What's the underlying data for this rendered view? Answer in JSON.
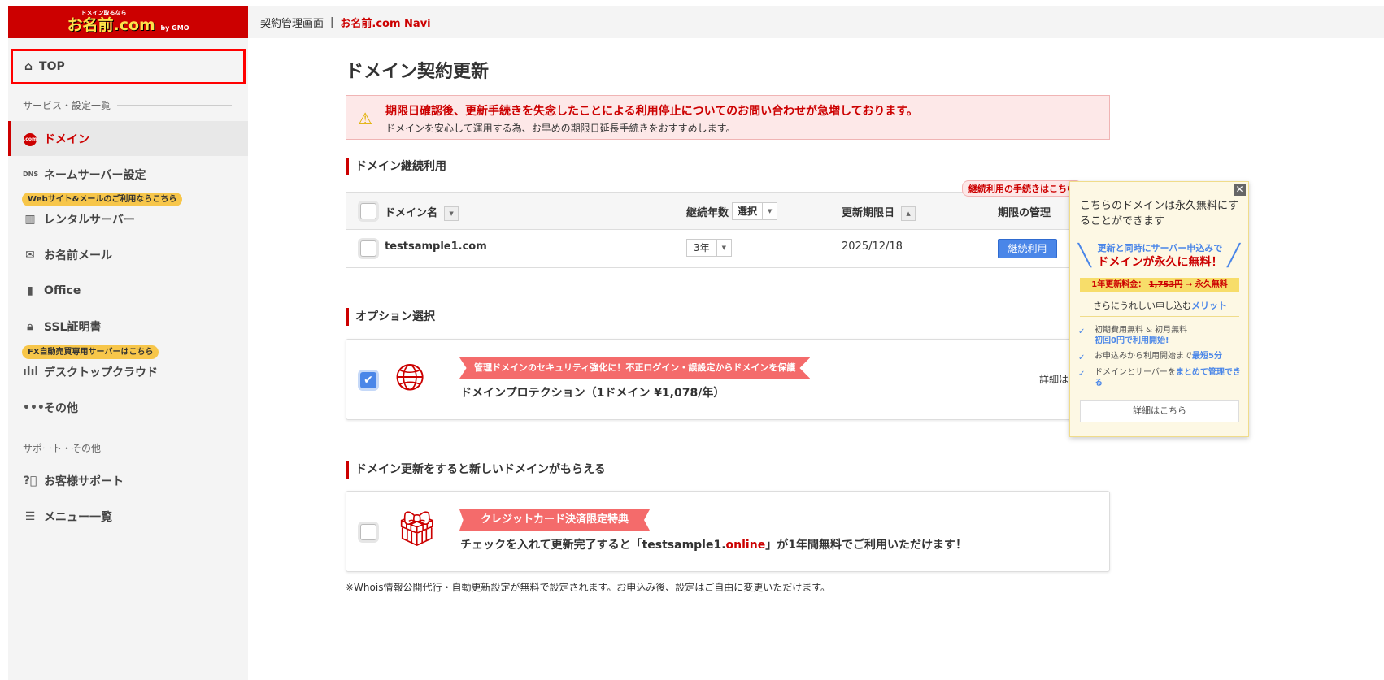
{
  "header": {
    "logo_tagline": "ドメイン取るなら",
    "logo_text": "お名前.com",
    "logo_by": "by GMO",
    "breadcrumb": "契約管理画面",
    "separator": "|",
    "app_name": "お名前.com Navi"
  },
  "sidebar": {
    "top": "TOP",
    "section_services": "サービス・設定一覧",
    "items": [
      {
        "label": "ドメイン",
        "icon": "dotcom-icon",
        "active": true
      },
      {
        "label": "ネームサーバー設定",
        "icon": "dns-icon"
      },
      {
        "label": "レンタルサーバー",
        "icon": "server-icon",
        "badge": "Webサイト&メールのご利用ならこちら"
      },
      {
        "label": "お名前メール",
        "icon": "mail-icon"
      },
      {
        "label": "Office",
        "icon": "office-icon"
      },
      {
        "label": "SSL証明書",
        "icon": "lock-icon"
      },
      {
        "label": "デスクトップクラウド",
        "icon": "chart-candle-icon",
        "badge": "FX自動売買専用サーバーはこちら"
      },
      {
        "label": "その他",
        "icon": "more-icon"
      }
    ],
    "section_support": "サポート・その他",
    "support_items": [
      {
        "label": "お客様サポート",
        "icon": "help-icon"
      },
      {
        "label": "メニュー一覧",
        "icon": "list-icon"
      }
    ]
  },
  "main": {
    "title": "ドメイン契約更新",
    "alert": {
      "title": "期限日確認後、更新手続きを失念したことによる利用停止についてのお問い合わせが急増しております。",
      "body": "ドメインを安心して運用する為、お早めの期限日延長手続きをおすすめします。"
    },
    "section1": "ドメイン継続利用",
    "table": {
      "headers": {
        "domain": "ドメイン名",
        "years": "継続年数",
        "years_select": "選択",
        "expiry": "更新期限日",
        "manage": "期限の管理"
      },
      "tip": "継続利用の手続きはこちら",
      "rows": [
        {
          "domain": "testsample1.com",
          "years": "3年",
          "expiry": "2025/12/18",
          "action": "継続利用",
          "checked": false
        }
      ]
    },
    "section2": "オプション選択",
    "option": {
      "ribbon": "管理ドメインのセキュリティ強化に！不正ログイン・誤設定からドメインを保護",
      "label": "ドメインプロテクション（1ドメイン ¥1,078/年）",
      "details": "詳細は",
      "checked": true
    },
    "section3": "ドメイン更新をすると新しいドメインがもらえる",
    "gift": {
      "ribbon": "クレジットカード決済限定特典",
      "text_before": "チェックを入れて更新完了すると「testsample1.",
      "text_highlight": "online",
      "text_after": "」が1年間無料でご利用いただけます！",
      "checked": false
    },
    "note": "※Whois情報公開代行・自動更新設定が無料で設定されます。お申込み後、設定はご自由に変更いただけます。"
  },
  "popup": {
    "close": "✕",
    "question": "こちらのドメインは永久無料にすることができます",
    "catch1": "更新と同時にサーバー申込みで",
    "catch2": "ドメインが永久に無料！",
    "price_label": "1年更新料金：",
    "price_old": "1,753円",
    "price_new": "→ 永久無料",
    "more_prefix": "さらにうれしい申し込む",
    "more_highlight": "メリット",
    "points": [
      {
        "text": "初期費用無料 & 初月無料",
        "highlight": "初回0円で利用開始!"
      },
      {
        "text": "お申込みから利用開始まで",
        "highlight": "最短5分"
      },
      {
        "text": "ドメインとサーバーを",
        "highlight": "まとめて管理できる"
      }
    ],
    "details_button": "詳細はこちら"
  },
  "colors": {
    "brand_red": "#cc0000",
    "accent_blue": "#4a86e8",
    "badge_yellow": "#f7c64a",
    "ribbon": "#f46b6b"
  }
}
